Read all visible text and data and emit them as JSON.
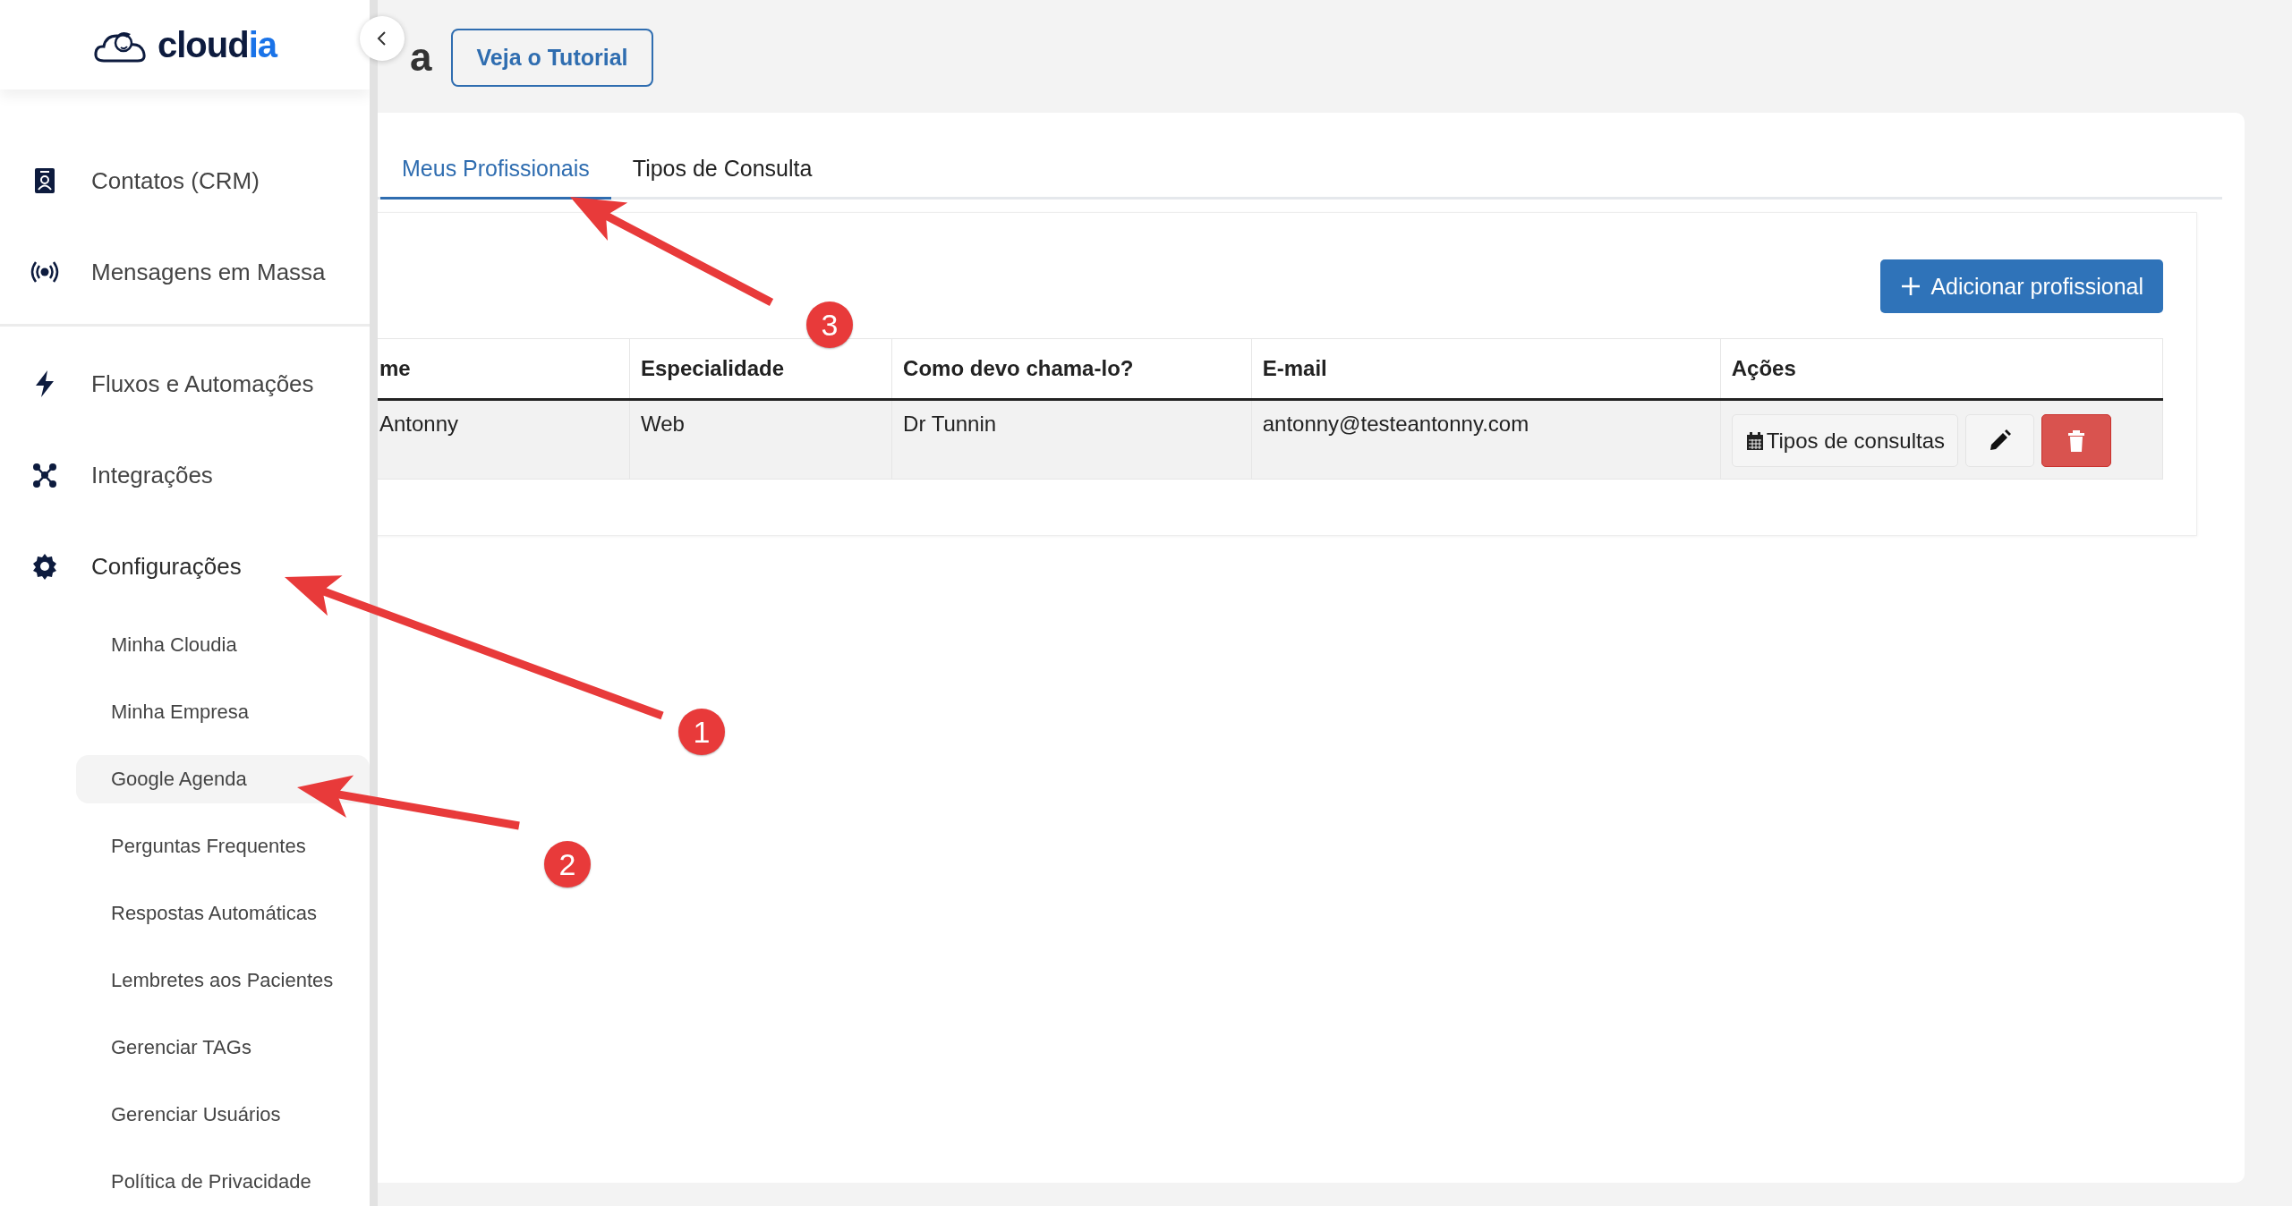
{
  "header": {
    "title": "a",
    "tutorial_button": "Veja o Tutorial"
  },
  "sidebar": {
    "logo": {
      "text": "cloud",
      "accent": "ia"
    },
    "groups": [
      {
        "items": [
          {
            "label": "Contatos (CRM)"
          },
          {
            "label": "Mensagens em Massa"
          }
        ]
      },
      {
        "items": [
          {
            "label": "Fluxos e Automações"
          },
          {
            "label": "Integrações"
          },
          {
            "label": "Configurações",
            "expanded": true,
            "children": [
              {
                "label": "Minha Cloudia",
                "highlighted": false
              },
              {
                "label": "Minha Empresa",
                "highlighted": false
              },
              {
                "label": "Google Agenda",
                "highlighted": true
              },
              {
                "label": "Perguntas Frequentes",
                "highlighted": false
              },
              {
                "label": "Respostas Automáticas",
                "highlighted": false
              },
              {
                "label": "Lembretes aos Pacientes",
                "highlighted": false
              },
              {
                "label": "Gerenciar TAGs",
                "highlighted": false
              },
              {
                "label": "Gerenciar Usuários",
                "highlighted": false
              },
              {
                "label": "Política de Privacidade",
                "highlighted": false
              }
            ]
          }
        ]
      }
    ]
  },
  "tabs": [
    {
      "label": "Meus Profissionais",
      "selected": true
    },
    {
      "label": "Tipos de Consulta",
      "selected": false
    }
  ],
  "add_button": "Adicionar profissional",
  "table": {
    "columns": [
      "me",
      "Especialidade",
      "Como devo chama-lo?",
      "E-mail",
      "Ações"
    ],
    "rows": [
      {
        "cells": [
          "Antonny",
          "Web",
          "Dr Tunnin",
          "antonny@testeantonny.com"
        ],
        "types_button": "Tipos de consultas"
      }
    ]
  },
  "annotations": [
    {
      "label": "1"
    },
    {
      "label": "2"
    },
    {
      "label": "3"
    }
  ]
}
